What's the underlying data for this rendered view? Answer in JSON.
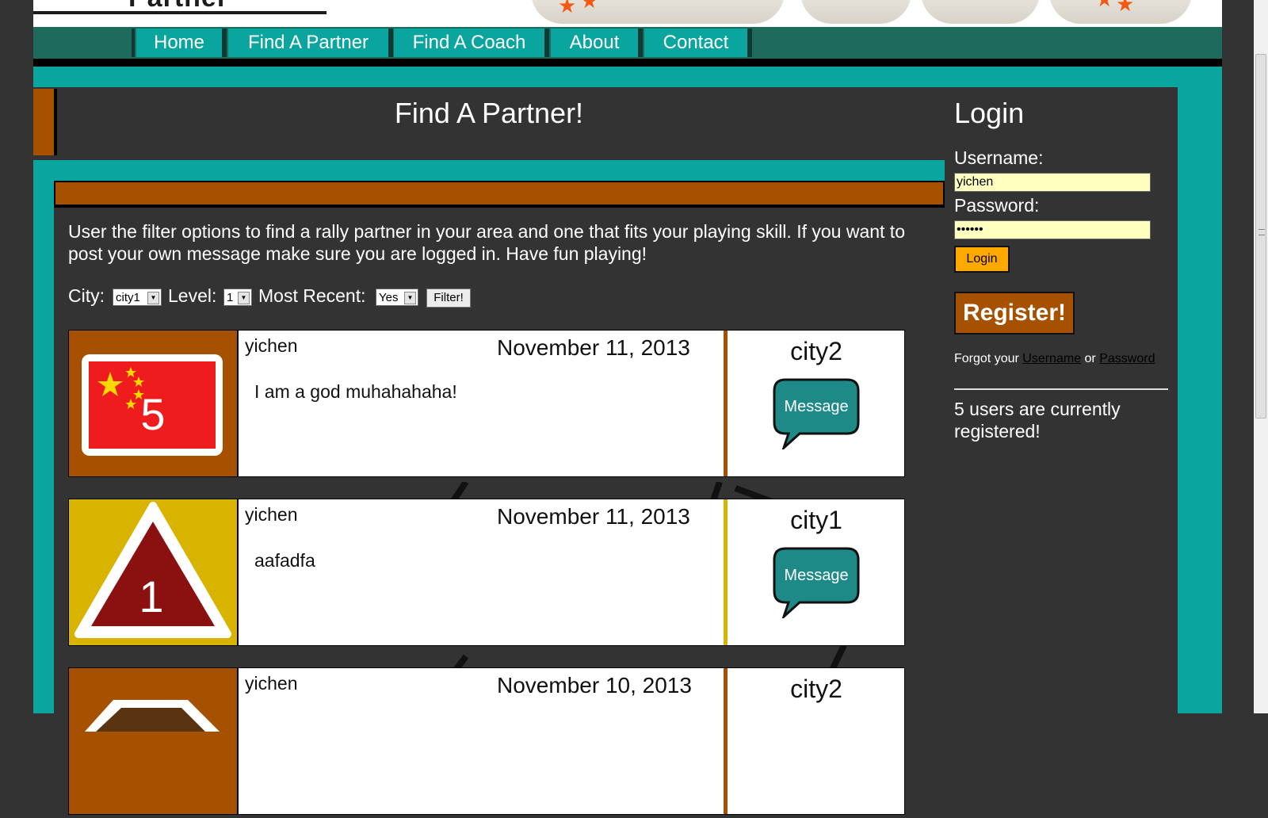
{
  "header": {
    "logo_text": "Partner"
  },
  "nav": {
    "items": [
      {
        "label": "Home"
      },
      {
        "label": "Find A Partner"
      },
      {
        "label": "Find A Coach"
      },
      {
        "label": "About"
      },
      {
        "label": "Contact"
      }
    ]
  },
  "main": {
    "title": "Find A Partner!",
    "intro": "User the filter options to find a rally partner in your area and one that fits your playing skill. If you want to post your own message make sure you are logged in. Have fun playing!",
    "filters": {
      "city_label": "City:",
      "city_value": "city1",
      "level_label": "Level:",
      "level_value": "1",
      "recent_label": "Most Recent:",
      "recent_value": "Yes",
      "button_label": "Filter!"
    },
    "posts": [
      {
        "user": "yichen",
        "date": "November 11, 2013",
        "message": "I am a god muhahahaha!",
        "city": "city2",
        "level": "5",
        "icon": "china-flag-level-icon",
        "accent": "#a55100",
        "button": "Message"
      },
      {
        "user": "yichen",
        "date": "November 11, 2013",
        "message": "aafadfa",
        "city": "city1",
        "level": "1",
        "icon": "triangle-level-icon",
        "accent": "#d8b400",
        "button": "Message"
      },
      {
        "user": "yichen",
        "date": "November 10, 2013",
        "message": "",
        "city": "city2",
        "level": "",
        "icon": "octagon-level-icon",
        "accent": "#a55100",
        "button": ""
      }
    ]
  },
  "sidebar": {
    "title": "Login",
    "username_label": "Username:",
    "username_value": "yichen",
    "password_label": "Password:",
    "password_value": "••••••",
    "login_button": "Login",
    "register_button": "Register!",
    "forgot_prefix": "Forgot your",
    "forgot_username": "Username",
    "forgot_or": "or",
    "forgot_password": "Password",
    "users_count": "5 users are currently registered!"
  },
  "colors": {
    "teal": "#0aa59e",
    "dark_bg": "#333333",
    "nav_dark": "#1e6b5e",
    "brown_accent": "#a55100",
    "gold_accent": "#d8b400",
    "login_orange": "#ffa800",
    "input_yellow": "#ffffc0"
  }
}
